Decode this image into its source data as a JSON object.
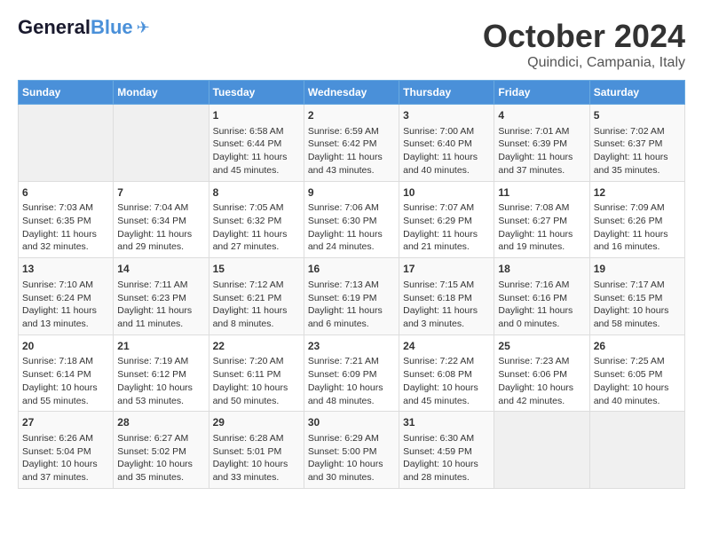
{
  "header": {
    "logo_general": "General",
    "logo_blue": "Blue",
    "month_title": "October 2024",
    "location": "Quindici, Campania, Italy"
  },
  "days_of_week": [
    "Sunday",
    "Monday",
    "Tuesday",
    "Wednesday",
    "Thursday",
    "Friday",
    "Saturday"
  ],
  "weeks": [
    [
      {
        "day": "",
        "info": ""
      },
      {
        "day": "",
        "info": ""
      },
      {
        "day": "1",
        "info": "Sunrise: 6:58 AM\nSunset: 6:44 PM\nDaylight: 11 hours and 45 minutes."
      },
      {
        "day": "2",
        "info": "Sunrise: 6:59 AM\nSunset: 6:42 PM\nDaylight: 11 hours and 43 minutes."
      },
      {
        "day": "3",
        "info": "Sunrise: 7:00 AM\nSunset: 6:40 PM\nDaylight: 11 hours and 40 minutes."
      },
      {
        "day": "4",
        "info": "Sunrise: 7:01 AM\nSunset: 6:39 PM\nDaylight: 11 hours and 37 minutes."
      },
      {
        "day": "5",
        "info": "Sunrise: 7:02 AM\nSunset: 6:37 PM\nDaylight: 11 hours and 35 minutes."
      }
    ],
    [
      {
        "day": "6",
        "info": "Sunrise: 7:03 AM\nSunset: 6:35 PM\nDaylight: 11 hours and 32 minutes."
      },
      {
        "day": "7",
        "info": "Sunrise: 7:04 AM\nSunset: 6:34 PM\nDaylight: 11 hours and 29 minutes."
      },
      {
        "day": "8",
        "info": "Sunrise: 7:05 AM\nSunset: 6:32 PM\nDaylight: 11 hours and 27 minutes."
      },
      {
        "day": "9",
        "info": "Sunrise: 7:06 AM\nSunset: 6:30 PM\nDaylight: 11 hours and 24 minutes."
      },
      {
        "day": "10",
        "info": "Sunrise: 7:07 AM\nSunset: 6:29 PM\nDaylight: 11 hours and 21 minutes."
      },
      {
        "day": "11",
        "info": "Sunrise: 7:08 AM\nSunset: 6:27 PM\nDaylight: 11 hours and 19 minutes."
      },
      {
        "day": "12",
        "info": "Sunrise: 7:09 AM\nSunset: 6:26 PM\nDaylight: 11 hours and 16 minutes."
      }
    ],
    [
      {
        "day": "13",
        "info": "Sunrise: 7:10 AM\nSunset: 6:24 PM\nDaylight: 11 hours and 13 minutes."
      },
      {
        "day": "14",
        "info": "Sunrise: 7:11 AM\nSunset: 6:23 PM\nDaylight: 11 hours and 11 minutes."
      },
      {
        "day": "15",
        "info": "Sunrise: 7:12 AM\nSunset: 6:21 PM\nDaylight: 11 hours and 8 minutes."
      },
      {
        "day": "16",
        "info": "Sunrise: 7:13 AM\nSunset: 6:19 PM\nDaylight: 11 hours and 6 minutes."
      },
      {
        "day": "17",
        "info": "Sunrise: 7:15 AM\nSunset: 6:18 PM\nDaylight: 11 hours and 3 minutes."
      },
      {
        "day": "18",
        "info": "Sunrise: 7:16 AM\nSunset: 6:16 PM\nDaylight: 11 hours and 0 minutes."
      },
      {
        "day": "19",
        "info": "Sunrise: 7:17 AM\nSunset: 6:15 PM\nDaylight: 10 hours and 58 minutes."
      }
    ],
    [
      {
        "day": "20",
        "info": "Sunrise: 7:18 AM\nSunset: 6:14 PM\nDaylight: 10 hours and 55 minutes."
      },
      {
        "day": "21",
        "info": "Sunrise: 7:19 AM\nSunset: 6:12 PM\nDaylight: 10 hours and 53 minutes."
      },
      {
        "day": "22",
        "info": "Sunrise: 7:20 AM\nSunset: 6:11 PM\nDaylight: 10 hours and 50 minutes."
      },
      {
        "day": "23",
        "info": "Sunrise: 7:21 AM\nSunset: 6:09 PM\nDaylight: 10 hours and 48 minutes."
      },
      {
        "day": "24",
        "info": "Sunrise: 7:22 AM\nSunset: 6:08 PM\nDaylight: 10 hours and 45 minutes."
      },
      {
        "day": "25",
        "info": "Sunrise: 7:23 AM\nSunset: 6:06 PM\nDaylight: 10 hours and 42 minutes."
      },
      {
        "day": "26",
        "info": "Sunrise: 7:25 AM\nSunset: 6:05 PM\nDaylight: 10 hours and 40 minutes."
      }
    ],
    [
      {
        "day": "27",
        "info": "Sunrise: 6:26 AM\nSunset: 5:04 PM\nDaylight: 10 hours and 37 minutes."
      },
      {
        "day": "28",
        "info": "Sunrise: 6:27 AM\nSunset: 5:02 PM\nDaylight: 10 hours and 35 minutes."
      },
      {
        "day": "29",
        "info": "Sunrise: 6:28 AM\nSunset: 5:01 PM\nDaylight: 10 hours and 33 minutes."
      },
      {
        "day": "30",
        "info": "Sunrise: 6:29 AM\nSunset: 5:00 PM\nDaylight: 10 hours and 30 minutes."
      },
      {
        "day": "31",
        "info": "Sunrise: 6:30 AM\nSunset: 4:59 PM\nDaylight: 10 hours and 28 minutes."
      },
      {
        "day": "",
        "info": ""
      },
      {
        "day": "",
        "info": ""
      }
    ]
  ]
}
